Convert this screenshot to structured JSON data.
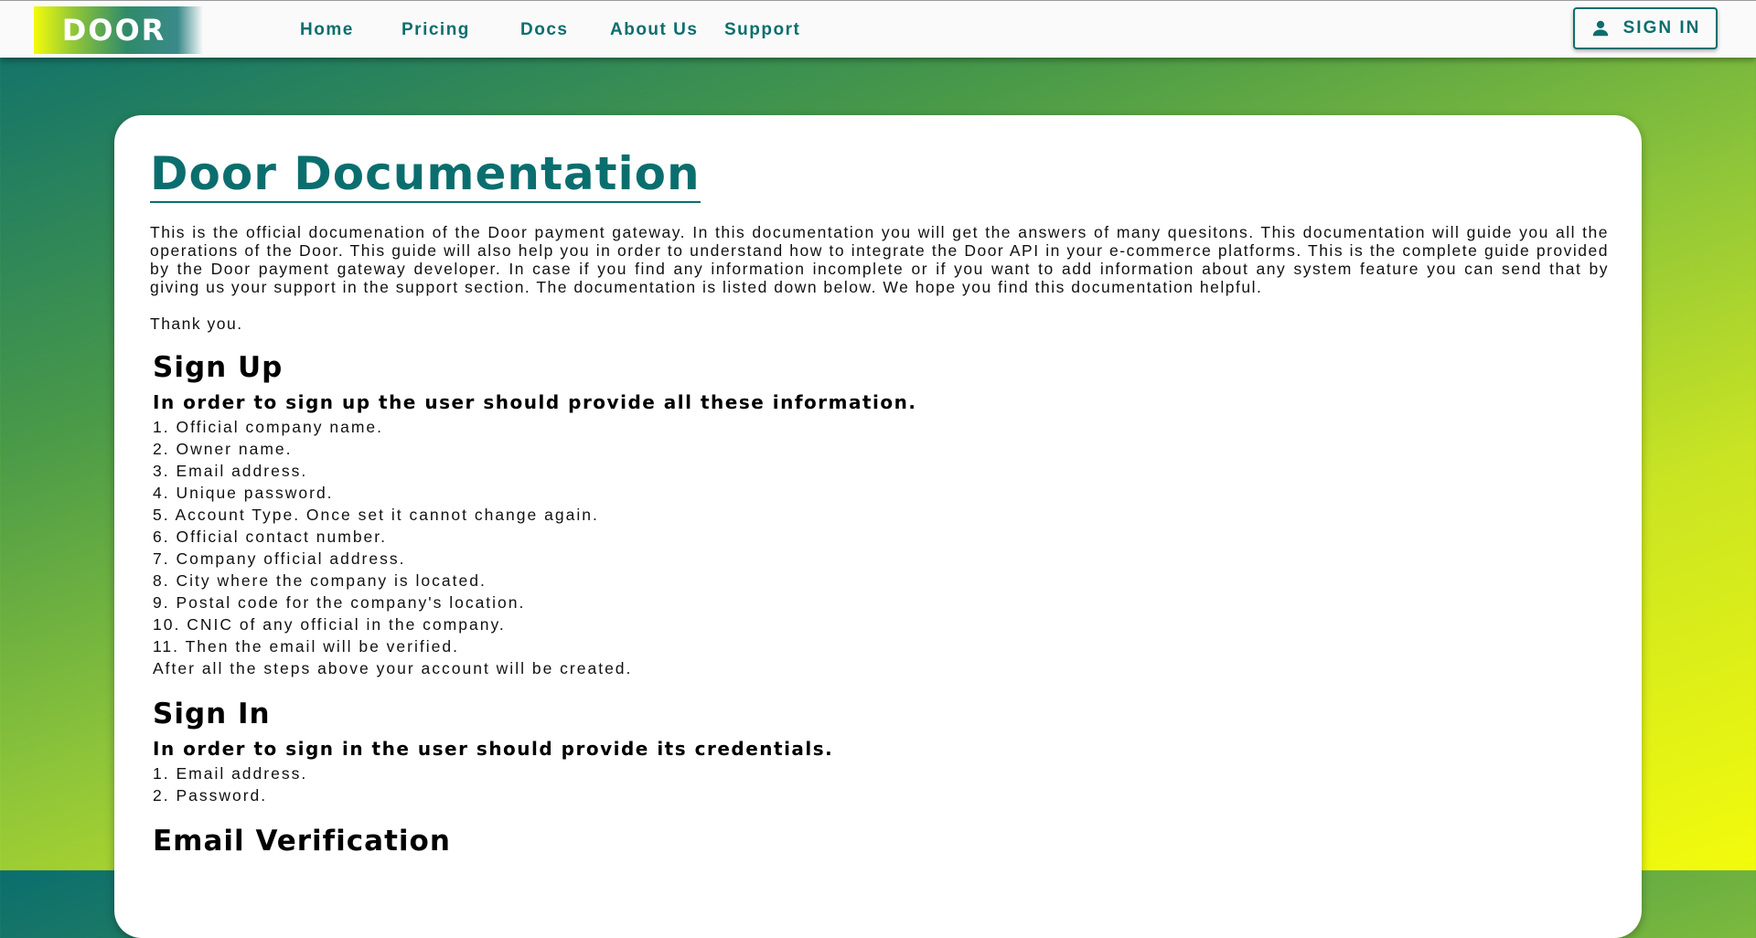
{
  "brand": {
    "logo_text": "DOOR"
  },
  "nav": {
    "links": [
      "Home",
      "Pricing",
      "Docs",
      "About Us",
      "Support"
    ],
    "signin_label": "SIGN IN"
  },
  "doc": {
    "title": "Door Documentation",
    "intro": "This is the official documenation of the Door payment gateway. In this documentation you will get the answers of many quesitons. This documentation will guide you all the operations of the Door. This guide will also help you in order to understand how to integrate the Door API in your e-commerce platforms. This is the complete guide provided by the Door payment gateway developer. In case if you find any information incomplete or if you want to add information about any system feature you can send that by giving us your support in the support section. The documentation is listed down below. We hope you find this documentation helpful.",
    "thanks": "Thank you.",
    "sections": [
      {
        "heading": "Sign Up",
        "subheading": "In order to sign up the user should provide all these information.",
        "items": [
          "1. Official company name.",
          "2. Owner name.",
          "3. Email address.",
          "4. Unique password.",
          "5. Account Type. Once set it cannot change again.",
          "6. Official contact number.",
          "7. Company official address.",
          "8. City where the company is located.",
          "9. Postal code for the company's location.",
          "10. CNIC of any official in the company.",
          "11. Then the email will be verified."
        ],
        "after": "After all the steps above your account will be created."
      },
      {
        "heading": "Sign In",
        "subheading": "In order to sign in the user should provide its credentials.",
        "items": [
          "1. Email address.",
          "2. Password."
        ]
      },
      {
        "heading": "Email Verification"
      }
    ]
  },
  "colors": {
    "accent": "#0b6e6e",
    "gradient_end": "#f3fb0c"
  },
  "icons": {
    "signin": "person-icon"
  }
}
